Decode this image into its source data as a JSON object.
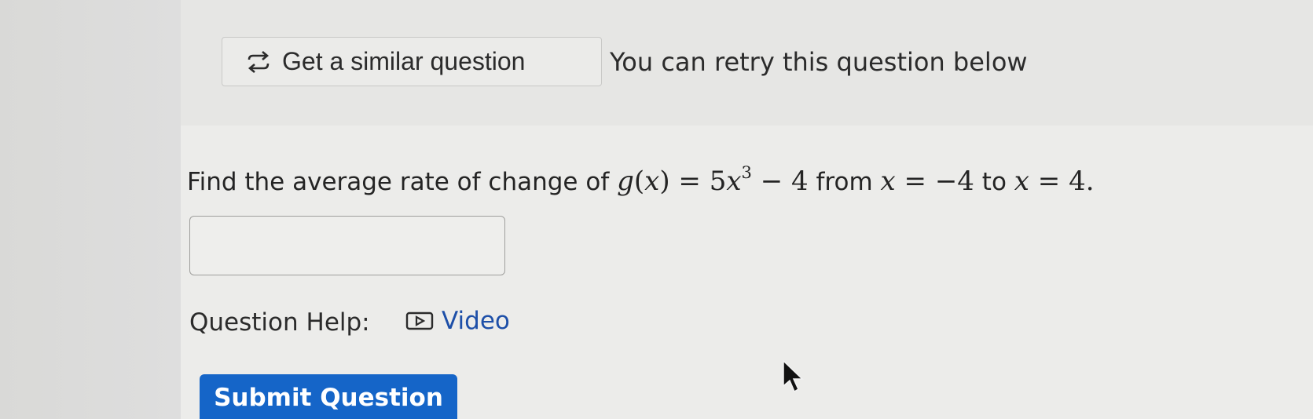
{
  "top_bar": {
    "similar_button_label": "Get a similar question",
    "similar_icon": "swap-arrows-icon",
    "retry_message": "You can retry this question below"
  },
  "question": {
    "prefix": "Find the average rate of change of",
    "function_name": "g",
    "variable": "x",
    "coefficient": "5",
    "exponent": "3",
    "constant": "4",
    "from_word": "from",
    "start_value": "−4",
    "to_word": "to",
    "end_value": "4"
  },
  "answer": {
    "value": "",
    "placeholder": ""
  },
  "help": {
    "label": "Question Help:",
    "video_label": "Video",
    "video_icon": "play-video-icon"
  },
  "submit": {
    "label": "Submit Question",
    "color": "#1565c8"
  }
}
